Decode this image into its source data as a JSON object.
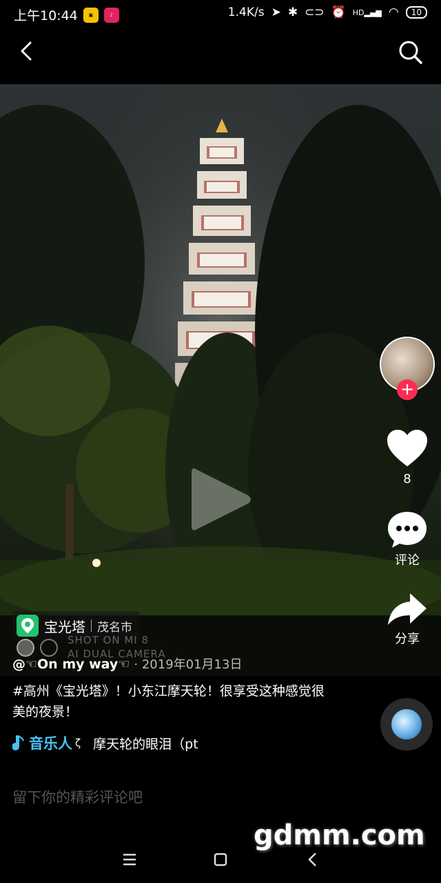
{
  "status_bar": {
    "time": "上午10:44",
    "network_speed": "1.4K/s",
    "battery": "10",
    "signal_label": "HD"
  },
  "video": {
    "location": {
      "name": "宝光塔",
      "city": "茂名市"
    },
    "camera_watermark": [
      "SHOT ON MI 8",
      "AI DUAL CAMERA"
    ],
    "author": "@☜On my way☜",
    "date": "· 2019年01月13日",
    "caption": "#高州《宝光塔》！小东江摩天轮！很享受这种感觉很美的夜景！",
    "music": {
      "author": "音乐人",
      "separator": "ζ",
      "title": "摩天轮的眼泪（pt"
    }
  },
  "actions": {
    "likes": "8",
    "comment_label": "评论",
    "share_label": "分享",
    "follow_plus": "+"
  },
  "comment_input": {
    "placeholder": "留下你的精彩评论吧"
  },
  "site_watermark": "gdmm.com"
}
